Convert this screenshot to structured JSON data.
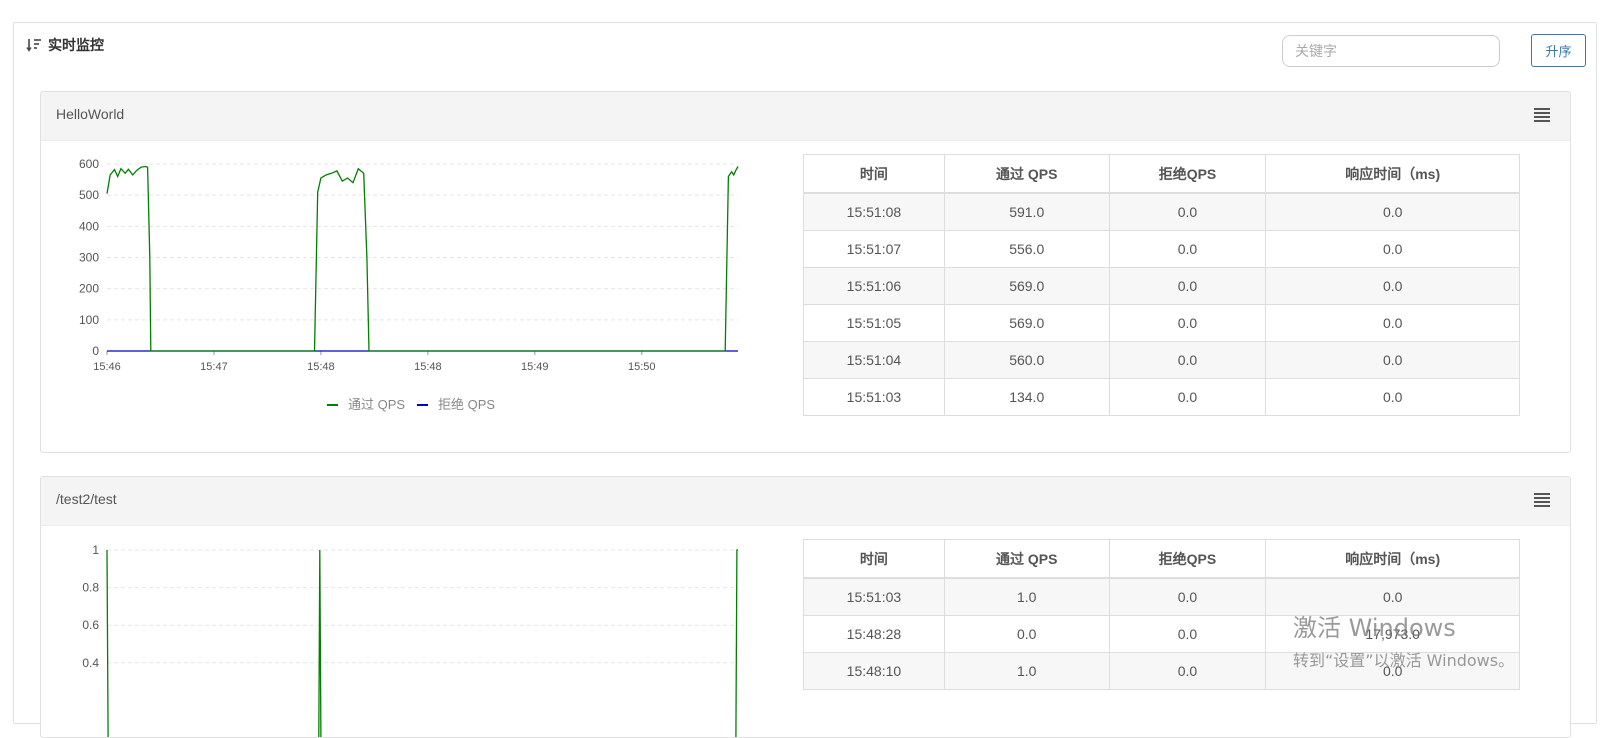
{
  "header": {
    "title": "实时监控",
    "search_placeholder": "关键字",
    "sort_label": "升序"
  },
  "colors": {
    "pass": "#008000",
    "block": "#0000cc",
    "accent": "#337ab7"
  },
  "table_headers": [
    "时间",
    "通过 QPS",
    "拒绝QPS",
    "响应时间（ms)"
  ],
  "panels": [
    {
      "title": "HelloWorld",
      "rows": [
        [
          "15:51:08",
          "591.0",
          "0.0",
          "0.0"
        ],
        [
          "15:51:07",
          "556.0",
          "0.0",
          "0.0"
        ],
        [
          "15:51:06",
          "569.0",
          "0.0",
          "0.0"
        ],
        [
          "15:51:05",
          "569.0",
          "0.0",
          "0.0"
        ],
        [
          "15:51:04",
          "560.0",
          "0.0",
          "0.0"
        ],
        [
          "15:51:03",
          "134.0",
          "0.0",
          "0.0"
        ]
      ]
    },
    {
      "title": "/test2/test",
      "rows": [
        [
          "15:51:03",
          "1.0",
          "0.0",
          "0.0"
        ],
        [
          "15:48:28",
          "0.0",
          "0.0",
          "17,973.0"
        ],
        [
          "15:48:10",
          "1.0",
          "0.0",
          "0.0"
        ]
      ]
    }
  ],
  "chart_data": [
    {
      "type": "line",
      "title": "",
      "x_tick_labels": [
        "15:46",
        "15:47",
        "15:48",
        "15:48",
        "15:49",
        "15:50"
      ],
      "x_range_minutes": [
        0,
        5.9
      ],
      "y_ticks": [
        0,
        100,
        200,
        300,
        400,
        500,
        600
      ],
      "ylim": [
        0,
        600
      ],
      "legend": [
        "通过 QPS",
        "拒绝 QPS"
      ],
      "series": [
        {
          "name": "通过 QPS",
          "x": [
            0.0,
            0.03,
            0.07,
            0.1,
            0.13,
            0.17,
            0.2,
            0.24,
            0.28,
            0.32,
            0.36,
            0.38,
            0.4,
            0.41,
            0.45,
            1.94,
            1.97,
            2.0,
            2.05,
            2.1,
            2.15,
            2.2,
            2.25,
            2.3,
            2.35,
            2.4,
            2.43,
            2.45,
            2.48,
            5.78,
            5.81,
            5.84,
            5.86,
            5.88,
            5.9
          ],
          "y": [
            505,
            565,
            582,
            560,
            585,
            570,
            583,
            565,
            580,
            590,
            592,
            590,
            300,
            0,
            0,
            0,
            510,
            555,
            565,
            570,
            578,
            545,
            555,
            540,
            585,
            570,
            300,
            0,
            0,
            0,
            560,
            575,
            565,
            580,
            592
          ]
        },
        {
          "name": "拒绝 QPS",
          "x": [
            0.0,
            5.9
          ],
          "y": [
            0,
            0
          ]
        }
      ]
    },
    {
      "type": "line",
      "title": "",
      "y_ticks": [
        0.4,
        0.6,
        0.8,
        1
      ],
      "ylim": [
        0,
        1
      ],
      "x_range_minutes": [
        0,
        5.9
      ],
      "series": [
        {
          "name": "通过 QPS",
          "x": [
            0.0,
            0.01,
            1.98,
            1.99,
            2.0,
            5.88,
            5.89,
            5.9
          ],
          "y": [
            1,
            0,
            0,
            1,
            0,
            0,
            1,
            1
          ]
        }
      ]
    }
  ],
  "watermark": {
    "line1": "激活 Windows",
    "line2": "转到“设置”以激活 Windows。"
  }
}
